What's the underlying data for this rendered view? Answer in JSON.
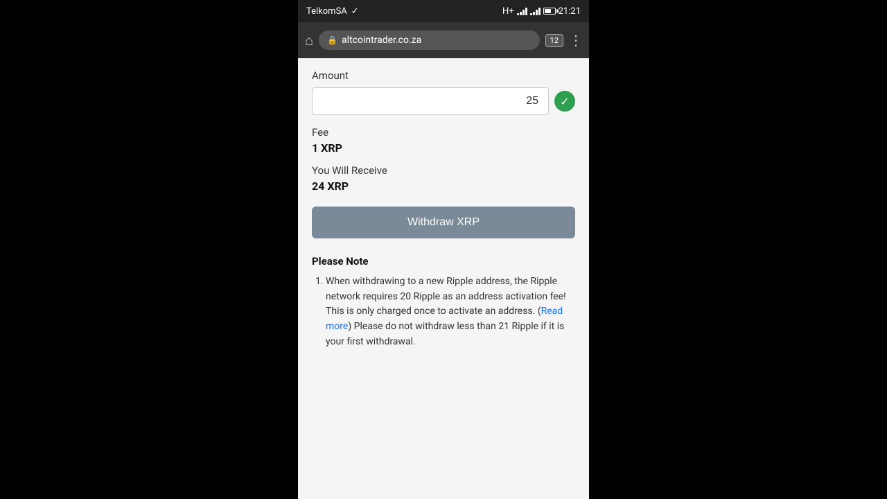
{
  "status_bar": {
    "carrier": "TelkomSA",
    "network": "H+",
    "time": "21:21",
    "tab_count": "12"
  },
  "browser": {
    "url": "altcointrader.co.za",
    "menu_dots": "⋮"
  },
  "form": {
    "amount_label": "Amount",
    "amount_value": "25",
    "fee_label": "Fee",
    "fee_value": "1 XRP",
    "receive_label": "You Will Receive",
    "receive_value": "24 XRP",
    "withdraw_button": "Withdraw XRP"
  },
  "notes": {
    "title": "Please Note",
    "items": [
      {
        "text_before": "When withdrawing to a new Ripple address, the Ripple network requires 20 Ripple as an address activation fee! This is only charged once to activate an address. (",
        "link_text": "Read more",
        "text_after": ") Please do not withdraw less than 21 Ripple if it is your first withdrawal."
      }
    ]
  }
}
